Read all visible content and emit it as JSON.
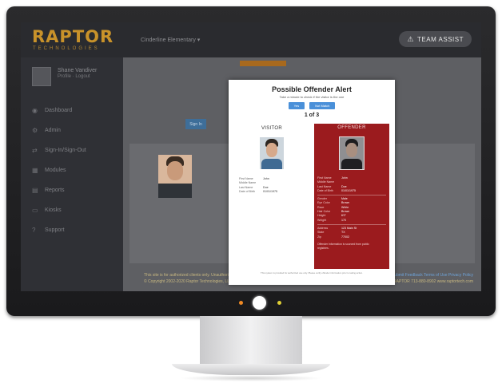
{
  "header": {
    "logo": "RAPTOR",
    "logo_sub": "TECHNOLOGIES",
    "location": "Cinderline Elementary ▾",
    "team_assist": "TEAM ASSIST"
  },
  "sidebar": {
    "user_name": "Shane Vandiver",
    "user_links": "Profile · Logout",
    "items": [
      {
        "label": "Dashboard",
        "icon": "◉"
      },
      {
        "label": "Admin",
        "icon": "⚙"
      },
      {
        "label": "Sign-In/Sign-Out",
        "icon": "⇄"
      },
      {
        "label": "Modules",
        "icon": "▦"
      },
      {
        "label": "Reports",
        "icon": "▤"
      },
      {
        "label": "Kiosks",
        "icon": "▭"
      },
      {
        "label": "Support",
        "icon": "?"
      }
    ]
  },
  "content": {
    "bg_button": "Sign In"
  },
  "modal": {
    "title": "Possible Offender Alert",
    "subtitle": "Take a minute to check if the visitor is the one ",
    "buttons": {
      "yes": "Yes",
      "not_match": "Not Match"
    },
    "pager": "1 of 3",
    "visitor": {
      "header": "VISITOR",
      "fields": [
        {
          "label": "First Name",
          "value": "John"
        },
        {
          "label": "Middle Name",
          "value": ""
        },
        {
          "label": "Last Name",
          "value": "Doe"
        },
        {
          "label": "Date of Birth",
          "value": "01/01/1975"
        }
      ]
    },
    "offender": {
      "header": "OFFENDER",
      "fields": [
        {
          "label": "First Name",
          "value": "John"
        },
        {
          "label": "Middle Name",
          "value": ""
        },
        {
          "label": "Last Name",
          "value": "Doe"
        },
        {
          "label": "Date of Birth",
          "value": "01/01/1975"
        }
      ],
      "details": [
        {
          "label": "Gender",
          "value": "Male"
        },
        {
          "label": "Eye Color",
          "value": "Brown"
        },
        {
          "label": "Race",
          "value": "White"
        },
        {
          "label": "Hair Color",
          "value": "Brown"
        },
        {
          "label": "Height",
          "value": "6'0\""
        },
        {
          "label": "Weight",
          "value": "170"
        }
      ],
      "location": [
        {
          "label": "Address",
          "value": "123 Main St"
        },
        {
          "label": "State",
          "value": "TX"
        },
        {
          "label": "Zip",
          "value": "77002"
        }
      ],
      "notes": "Offender information is sourced from public registries."
    },
    "fineprint": "This system is provided for authorized use only. Please verify offender information prior to taking action."
  },
  "footer": {
    "left_line1": "This site is for authorized clients only. Unauthorized use is prohibited.",
    "left_line2": "© Copyright 2002-2020 Raptor Technologies, LLC. All rights reserved.",
    "links": "Submit Feedback  Terms of Use  Privacy Policy",
    "right_line2": "v4.1.3.6134   1-877-7RAPTOR   713-880-8902   www.raptortech.com"
  }
}
